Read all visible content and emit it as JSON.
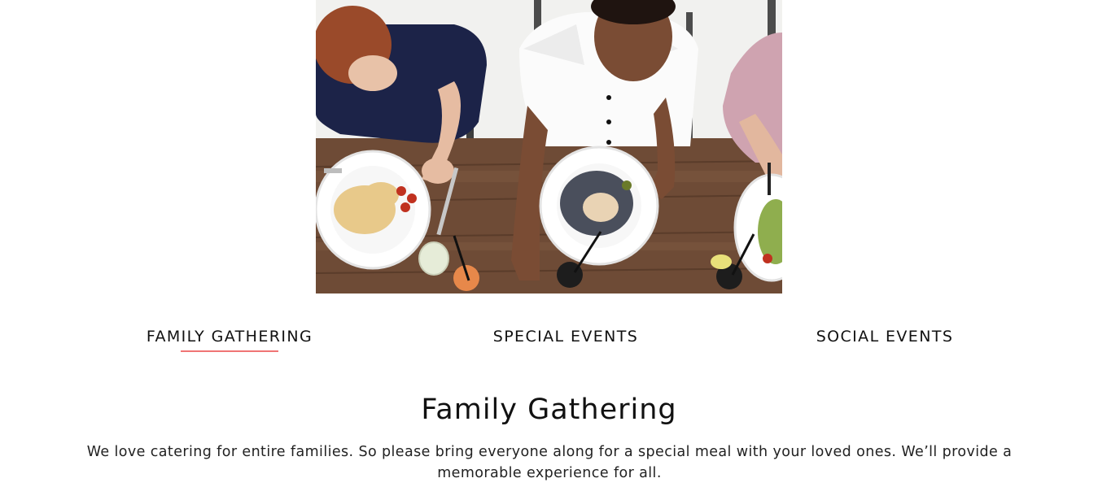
{
  "hero_image": {
    "alt": "Three people sharing pasta dishes at a wooden table, viewed from above"
  },
  "tabs": [
    {
      "label": "FAMILY GATHERING",
      "active": true
    },
    {
      "label": "SPECIAL EVENTS",
      "active": false
    },
    {
      "label": "SOCIAL EVENTS",
      "active": false
    }
  ],
  "content": {
    "title": "Family Gathering",
    "body": "We love catering for entire families. So please bring everyone along for a special meal with your loved ones. We’ll provide a memorable experience for all."
  },
  "colors": {
    "accent_underline": "#f07474",
    "text": "#111111",
    "background": "#ffffff"
  }
}
